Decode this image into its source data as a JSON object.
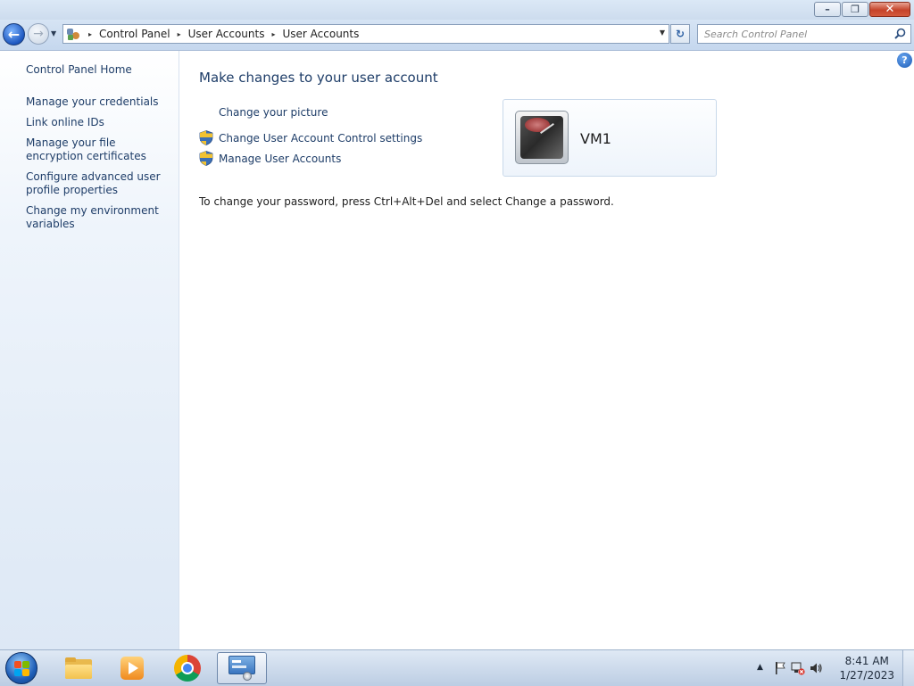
{
  "window": {
    "caption": {
      "minimize": "–",
      "maximize": "❐",
      "close": "✕"
    }
  },
  "nav": {
    "back_glyph": "←",
    "forward_glyph": "→",
    "recent_glyph": "▼",
    "breadcrumb": [
      "Control Panel",
      "User Accounts",
      "User Accounts"
    ],
    "crumb_separator": "▸",
    "address_dropdown": "▼",
    "refresh_glyph": "↻",
    "search_placeholder": "Search Control Panel",
    "search_value": ""
  },
  "sidebar": {
    "home": "Control Panel Home",
    "tasks": [
      "Manage your credentials",
      "Link online IDs",
      "Manage your file encryption certificates",
      "Configure advanced user profile properties",
      "Change my environment variables"
    ]
  },
  "main": {
    "help_glyph": "?",
    "title": "Make changes to your user account",
    "links": {
      "change_picture": "Change your picture",
      "uac_settings": "Change User Account Control settings",
      "manage_accounts": "Manage User Accounts"
    },
    "user": {
      "name": "VM1"
    },
    "password_note": "To change your password, press Ctrl+Alt+Del and select Change a password."
  },
  "taskbar": {
    "pinned": [
      "windows-explorer",
      "windows-media-player",
      "google-chrome",
      "control-panel"
    ],
    "tray_arrow": "▲",
    "clock": {
      "time": "8:41 AM",
      "date": "1/27/2023"
    }
  },
  "colors": {
    "link": "#1e3d68",
    "title": "#1e3d68",
    "sidebar_bg": "#dde8f5",
    "taskbar_bg": "#bccde3"
  }
}
